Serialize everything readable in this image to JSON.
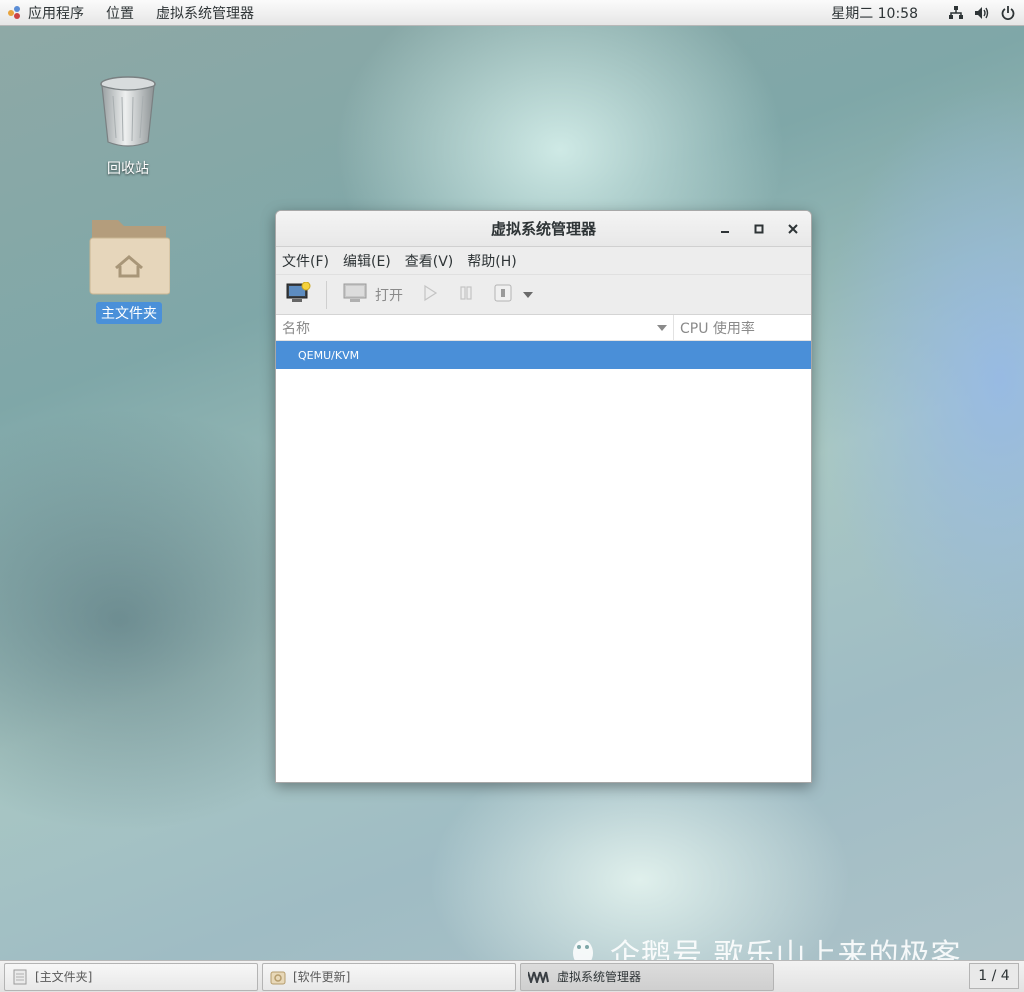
{
  "top_panel": {
    "apps_label": "应用程序",
    "places_label": "位置",
    "active_app_label": "虚拟系统管理器",
    "clock": "星期二 10:58",
    "icons": [
      "network-icon",
      "volume-icon",
      "power-icon"
    ]
  },
  "desktop": {
    "trash_label": "回收站",
    "home_label": "主文件夹"
  },
  "window": {
    "title": "虚拟系统管理器",
    "menus": [
      "文件(F)",
      "编辑(E)",
      "查看(V)",
      "帮助(H)"
    ],
    "toolbar": {
      "open_label": "打开"
    },
    "columns": {
      "name": "名称",
      "cpu": "CPU 使用率"
    },
    "rows": [
      {
        "name": "QEMU/KVM",
        "selected": true
      }
    ]
  },
  "taskbar": {
    "tasks": [
      "[主文件夹]",
      "[软件更新]",
      "虚拟系统管理器"
    ],
    "pager": "1 / 4"
  },
  "watermark": "企鹅号 歌乐山上来的极客",
  "colors": {
    "selection": "#4a8fd8",
    "panel": "#ededed"
  }
}
